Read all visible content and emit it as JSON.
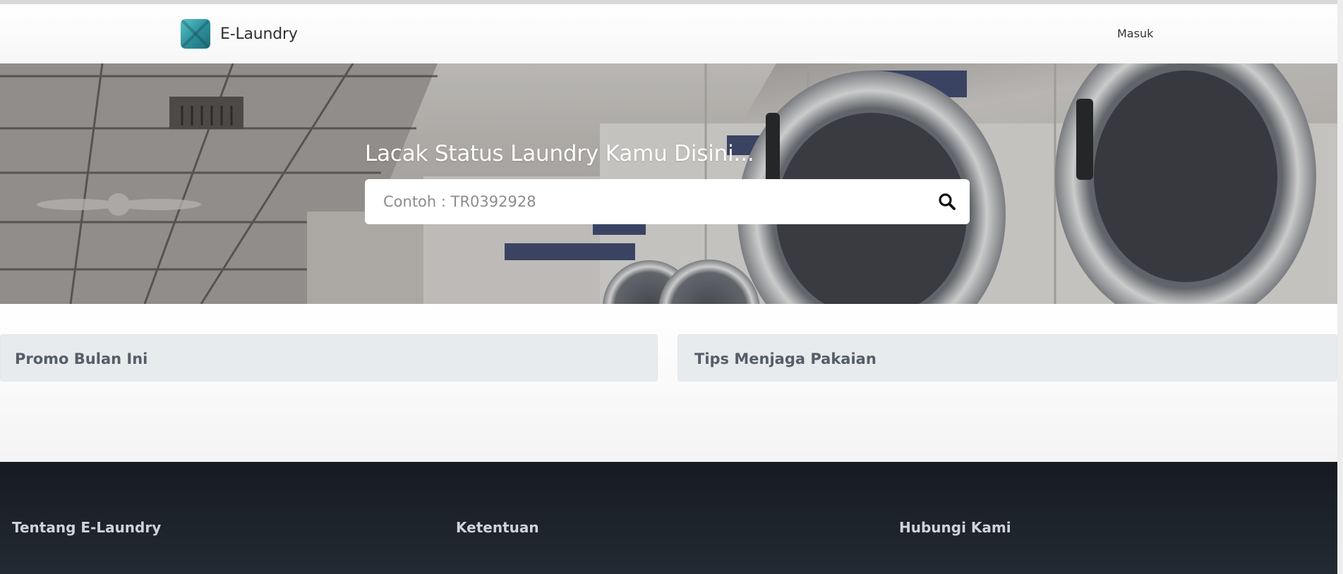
{
  "nav": {
    "brand": "E-Laundry",
    "login": "Masuk"
  },
  "hero": {
    "title": "Lacak Status Laundry Kamu Disini...",
    "search_placeholder": "Contoh : TR0392928",
    "search_icon": "search-icon"
  },
  "cards": [
    {
      "title": "Promo Bulan Ini"
    },
    {
      "title": "Tips Menjaga Pakaian"
    }
  ],
  "footer": {
    "headings": [
      "Tentang E-Laundry",
      "Ketentuan",
      "Hubungi Kami"
    ]
  },
  "colors": {
    "brand_logo": "#2b8d98",
    "footer_bg": "#1b2027",
    "card_bg": "#e8ebee",
    "card_text": "#555e67"
  }
}
